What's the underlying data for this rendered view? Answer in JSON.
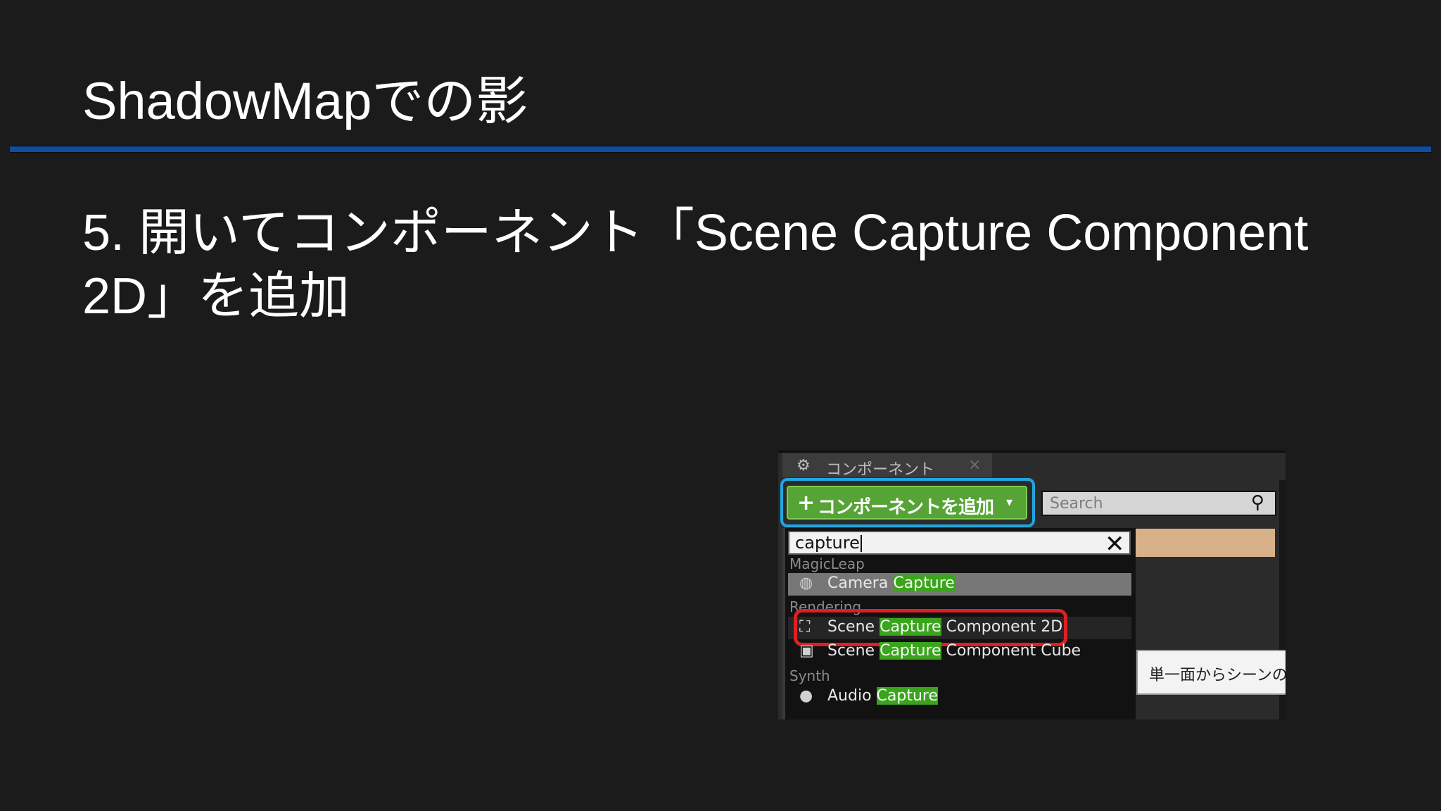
{
  "slide": {
    "title": "ShadowMapでの影",
    "step": "5. 開いてコンポーネント「Scene Capture Component 2D」を追加"
  },
  "editor": {
    "tab": {
      "label": "コンポーネント",
      "icon": "components-icon",
      "close_icon": "close-icon"
    },
    "add_button": {
      "plus": "+",
      "label": "コンポーネントを追加",
      "caret": "▾"
    },
    "search": {
      "placeholder": "Search",
      "icon": "search-icon"
    },
    "filter": {
      "value": "capture",
      "clear_icon": "close-icon"
    },
    "categories": [
      {
        "name": "MagicLeap",
        "items": [
          {
            "prefix": "Camera ",
            "match": "Capture",
            "suffix": "",
            "icon": "camera-icon"
          }
        ]
      },
      {
        "name": "Rendering",
        "items": [
          {
            "prefix": "Scene ",
            "match": "Capture",
            "suffix": " Component 2D",
            "icon": "scene-capture-2d-icon"
          },
          {
            "prefix": "Scene ",
            "match": "Capture",
            "suffix": " Component Cube",
            "icon": "scene-capture-cube-icon"
          }
        ]
      },
      {
        "name": "Synth",
        "items": [
          {
            "prefix": "Audio ",
            "match": "Capture",
            "suffix": "",
            "icon": "audio-icon"
          }
        ]
      }
    ],
    "tooltip": "単一面からシーンの",
    "colors": {
      "highlight_blue": "#1fa6df",
      "highlight_red": "#e01e23",
      "add_green": "#56a336",
      "match_green": "#3aa51c"
    }
  }
}
